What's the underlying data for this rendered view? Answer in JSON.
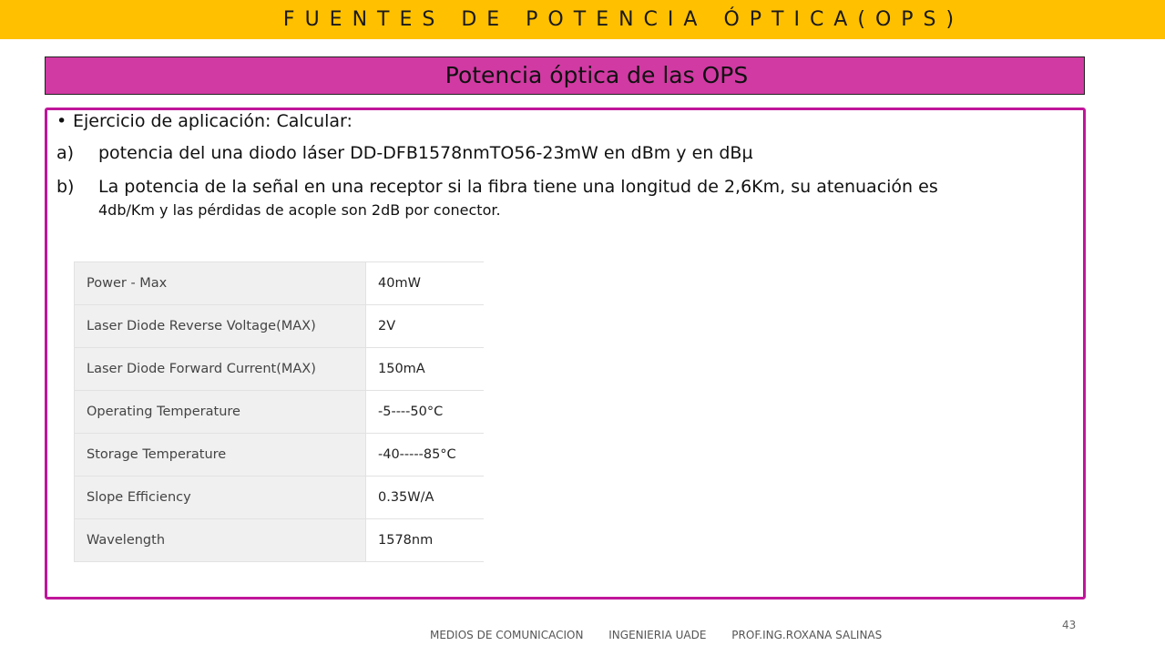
{
  "header": {
    "title": "FUENTES DE POTENCIA ÓPTICA(OPS)"
  },
  "banner": {
    "subtitle": "Potencia óptica de las OPS"
  },
  "content": {
    "bullet": "Ejercicio de aplicación: Calcular:",
    "items": [
      {
        "label": "a)",
        "text": "potencia del una diodo láser DD-DFB1578nmTO56-23mW en dBm y en dBµ",
        "cont": ""
      },
      {
        "label": "b)",
        "text": "La potencia de la señal en una receptor si la fibra tiene una longitud de 2,6Km, su atenuación es",
        "cont": "4db/Km y las pérdidas de acople son 2dB por conector."
      }
    ]
  },
  "specs_table": {
    "rows": [
      {
        "param": "Power - Max",
        "value": "40mW"
      },
      {
        "param": "Laser Diode Reverse Voltage(MAX)",
        "value": "2V"
      },
      {
        "param": "Laser Diode Forward Current(MAX)",
        "value": "150mA"
      },
      {
        "param": "Operating Temperature",
        "value": "-5----50°C"
      },
      {
        "param": "Storage Temperature",
        "value": "-40-----85°C"
      },
      {
        "param": "Slope Efficiency",
        "value": "0.35W/A"
      },
      {
        "param": "Wavelength",
        "value": "1578nm"
      }
    ]
  },
  "footer": {
    "course": "MEDIOS DE COMUNICACION",
    "institution": "INGENIERIA  UADE",
    "professor": "PROF.ING.ROXANA SALINAS",
    "page_number": "43"
  },
  "colors": {
    "header_bg": "#ffc000",
    "banner_bg": "#d13aa3",
    "border_accent": "#c0169a"
  }
}
